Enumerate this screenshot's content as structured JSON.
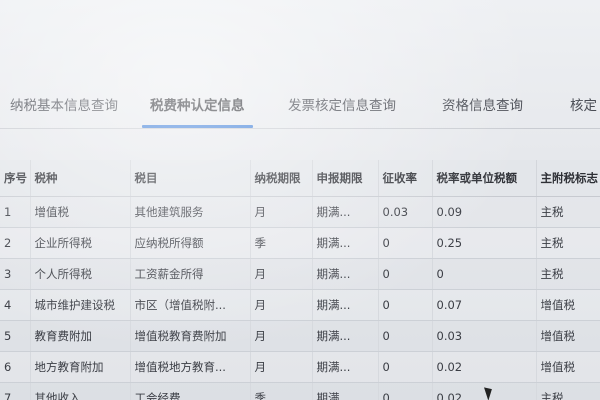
{
  "tabs": [
    {
      "label": "纳税基本信息查询",
      "active": false
    },
    {
      "label": "税费种认定信息",
      "active": true
    },
    {
      "label": "发票核定信息查询",
      "active": false
    },
    {
      "label": "资格信息查询",
      "active": false
    },
    {
      "label": "核定",
      "active": false
    }
  ],
  "table": {
    "headers": [
      "序号",
      "税种",
      "税目",
      "纳税期限",
      "申报期限",
      "征收率",
      "税率或单位税额",
      "主附税标志"
    ],
    "rows": [
      [
        "1",
        "增值税",
        "其他建筑服务",
        "月",
        "期满...",
        "0.03",
        "0.09",
        "主税"
      ],
      [
        "2",
        "企业所得税",
        "应纳税所得额",
        "季",
        "期满...",
        "0",
        "0.25",
        "主税"
      ],
      [
        "3",
        "个人所得税",
        "工资薪金所得",
        "月",
        "期满...",
        "0",
        "0",
        "主税"
      ],
      [
        "4",
        "城市维护建设税",
        "市区（增值税附...",
        "月",
        "期满...",
        "0",
        "0.07",
        "增值税"
      ],
      [
        "5",
        "教育费附加",
        "增值税教育费附加",
        "月",
        "期满...",
        "0",
        "0.03",
        "增值税"
      ],
      [
        "6",
        "地方教育附加",
        "增值税地方教育...",
        "月",
        "期满...",
        "0",
        "0.02",
        "增值税"
      ],
      [
        "7",
        "其他收入",
        "工会经费",
        "季",
        "期满...",
        "0",
        "0.02",
        "主税"
      ]
    ]
  }
}
